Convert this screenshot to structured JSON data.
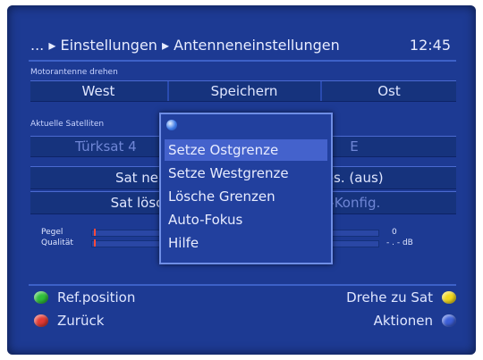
{
  "header": {
    "breadcrumb": "... ▸ Einstellungen ▸ Antenneneinstellungen",
    "clock": "12:45"
  },
  "motor": {
    "caption": "Motorantenne drehen",
    "west": "West",
    "save": "Speichern",
    "east": "Ost"
  },
  "satellite": {
    "caption": "Aktuelle Satelliten",
    "name": "Türksat 4",
    "name_suffix": "E"
  },
  "buttons": {
    "sat_new": "Sat ne",
    "pos": "Pos. (aus)",
    "sat_delete": "Sat lösc",
    "config": "8-Konfig."
  },
  "meters": {
    "level_label": "Pegel",
    "quality_label": "Qualität",
    "level_value": "0",
    "quality_value": "- . - dB",
    "level_fraction": 0.0,
    "quality_fraction": 0.0
  },
  "hints": {
    "green": "Ref.position",
    "red": "Zurück",
    "yellow": "Drehe zu Sat",
    "blue": "Aktionen"
  },
  "popup": {
    "items": [
      "Setze Ostgrenze",
      "Setze Westgrenze",
      "Lösche Grenzen",
      "Auto-Fokus",
      "Hilfe"
    ],
    "selected_index": 0
  },
  "colors": {
    "background": "#1d3a93",
    "green": "#2fbf3a",
    "red": "#e23a34",
    "yellow": "#f2d81e",
    "blue": "#3c5fd8"
  }
}
